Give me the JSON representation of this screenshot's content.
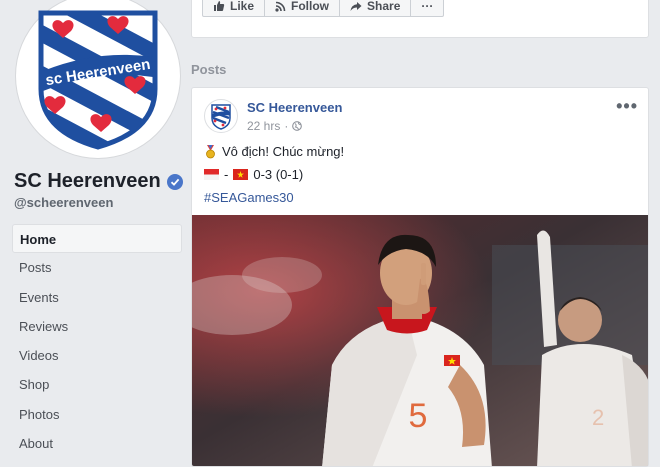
{
  "page": {
    "name": "SC Heerenveen",
    "handle": "@scheerenveen",
    "logo_text": "sc Heerenveen"
  },
  "actions": {
    "like_label": "Like",
    "follow_label": "Follow",
    "share_label": "Share",
    "more_label": "···"
  },
  "nav": {
    "items": [
      {
        "label": "Home",
        "active": true
      },
      {
        "label": "Posts"
      },
      {
        "label": "Events"
      },
      {
        "label": "Reviews"
      },
      {
        "label": "Videos"
      },
      {
        "label": "Shop"
      },
      {
        "label": "Photos"
      },
      {
        "label": "About"
      }
    ]
  },
  "posts_heading": "Posts",
  "post": {
    "author": "SC Heerenveen",
    "time": "22 hrs",
    "dot": "·",
    "more": "•••",
    "text_line1": "Vô địch! Chúc mừng!",
    "score_sep": "-",
    "score": "0-3 (0-1)",
    "hashtag": "#SEAGames30",
    "jersey_number": "5"
  },
  "colors": {
    "facebook_blue": "#4267b2",
    "link_blue": "#365899",
    "logo_blue": "#1f4fa0",
    "heart_red": "#e32b3d"
  },
  "icons": [
    "thumbs-up-icon",
    "rss-icon",
    "share-icon",
    "verified-icon",
    "globe-icon",
    "medal-icon",
    "indonesia-flag-icon",
    "vietnam-flag-icon"
  ]
}
